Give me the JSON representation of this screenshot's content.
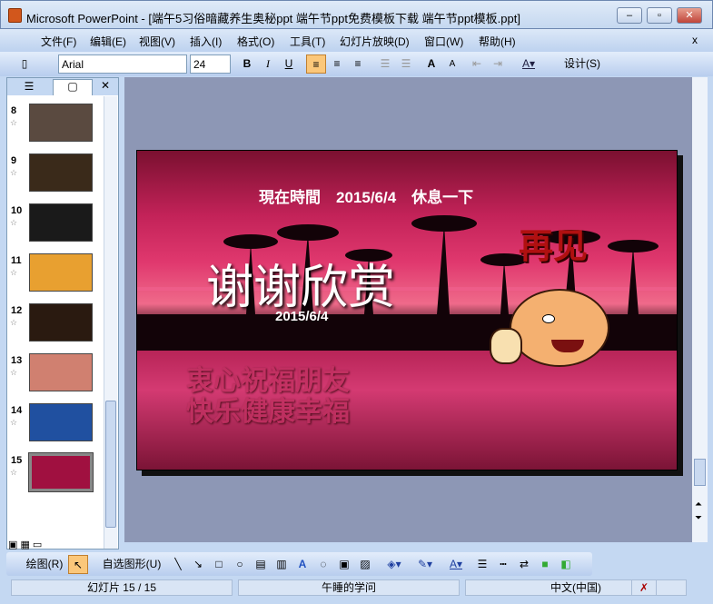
{
  "window": {
    "title": "Microsoft PowerPoint - [端午5习俗暗藏养生奥秘ppt 端午节ppt免费模板下载  端午节ppt模板.ppt]",
    "min": "–",
    "max": "▫",
    "close": "✕"
  },
  "menu": [
    "文件(F)",
    "编辑(E)",
    "视图(V)",
    "插入(I)",
    "格式(O)",
    "工具(T)",
    "幻灯片放映(D)",
    "窗口(W)",
    "帮助(H)"
  ],
  "menu_close": "x",
  "toolbar": {
    "font": "Arial",
    "size": "24",
    "bold": "B",
    "italic": "I",
    "underline": "U",
    "design": "设计(S)"
  },
  "slides": {
    "numbers": [
      "8",
      "9",
      "10",
      "11",
      "12",
      "13",
      "14",
      "15"
    ],
    "selected": "15",
    "colors": [
      "#5a4a40",
      "#3a2a1a",
      "#1a1a1a",
      "#e8a030",
      "#2a1a10",
      "#d08070",
      "#2050a0",
      "#a01040"
    ]
  },
  "slide": {
    "time_line": "現在時間　2015/6/4　休息一下",
    "title": "谢谢欣赏",
    "date": "2015/6/4",
    "farewell": "再见",
    "blessing1": "衷心祝福朋友",
    "blessing2": "快乐健康幸福"
  },
  "drawing": {
    "draw": "绘图(R)",
    "autoshapes": "自选图形(U)"
  },
  "status": {
    "slide": "幻灯片 15 / 15",
    "design": "午睡的学问",
    "lang": "中文(中国)"
  }
}
